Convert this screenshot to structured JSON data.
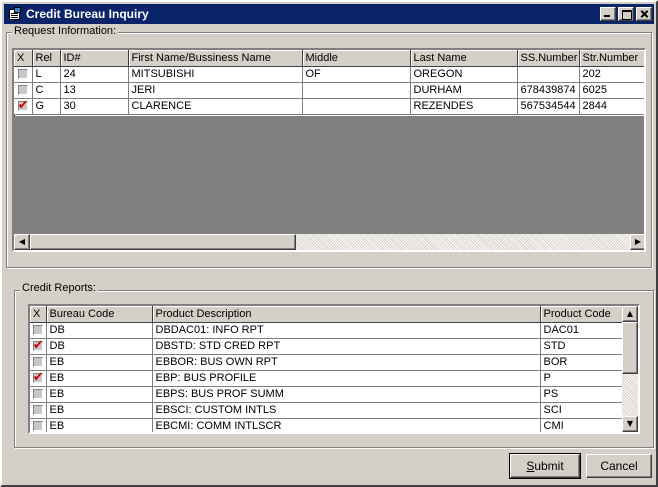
{
  "window": {
    "title": "Credit Bureau Inquiry"
  },
  "request": {
    "group_label": "Request Information:",
    "columns": [
      "X",
      "Rel",
      "ID#",
      "First Name/Bussiness Name",
      "Middle",
      "Last Name",
      "SS.Number",
      "Str.Number"
    ],
    "rows": [
      {
        "checked": false,
        "rel": "L",
        "id": "24",
        "first": "MITSUBISHI",
        "middle": "OF",
        "last": "OREGON",
        "ss": "",
        "str": "202"
      },
      {
        "checked": false,
        "rel": "C",
        "id": "13",
        "first": "JERI",
        "middle": "",
        "last": "DURHAM",
        "ss": "678439874",
        "str": "6025"
      },
      {
        "checked": true,
        "rel": "G",
        "id": "30",
        "first": "CLARENCE",
        "middle": "",
        "last": "REZENDES",
        "ss": "567534544",
        "str": "2844"
      }
    ],
    "check_mark": "✔"
  },
  "credit": {
    "group_label": "Credit Reports:",
    "columns": [
      "X",
      "Bureau Code",
      "Product Description",
      "Product Code"
    ],
    "rows": [
      {
        "checked": false,
        "bureau": "DB",
        "desc": "DBDAC01: INFO RPT",
        "code": "DAC01"
      },
      {
        "checked": true,
        "bureau": "DB",
        "desc": "DBSTD: STD CRED RPT",
        "code": "STD"
      },
      {
        "checked": false,
        "bureau": "EB",
        "desc": "EBBOR: BUS OWN RPT",
        "code": "BOR"
      },
      {
        "checked": true,
        "bureau": "EB",
        "desc": "EBP: BUS PROFILE",
        "code": "P"
      },
      {
        "checked": false,
        "bureau": "EB",
        "desc": "EBPS: BUS PROF SUMM",
        "code": "PS"
      },
      {
        "checked": false,
        "bureau": "EB",
        "desc": "EBSCI: CUSTOM INTLS",
        "code": "SCI"
      },
      {
        "checked": false,
        "bureau": "EB",
        "desc": "EBCMI: COMM INTLSCR",
        "code": "CMI"
      }
    ]
  },
  "buttons": {
    "submit_u": "S",
    "submit_rest": "ubmit",
    "cancel": "Cancel"
  },
  "icons": {
    "left": "◀",
    "right": "▶",
    "up": "▲",
    "down": "▼"
  }
}
